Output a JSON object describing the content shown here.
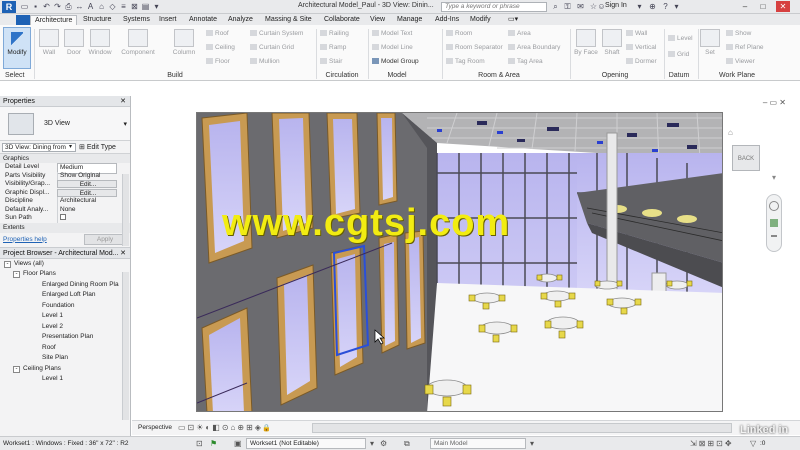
{
  "titlebar": {
    "logo": "R",
    "doc_title": "Architectural Model_Paul - 3D View: Dinin...",
    "search_placeholder": "Type a keyword or phrase",
    "sign_in": "Sign In"
  },
  "tabs": [
    "Architecture",
    "Structure",
    "Systems",
    "Insert",
    "Annotate",
    "Analyze",
    "Massing & Site",
    "Collaborate",
    "View",
    "Manage",
    "Add-Ins",
    "Modify"
  ],
  "ribbon": {
    "modify": "Modify",
    "select": "Select",
    "build_big": [
      "Wall",
      "Door",
      "Window",
      "Component",
      "Column"
    ],
    "build_small": [
      "Roof",
      "Ceiling",
      "Floor",
      "Curtain System",
      "Curtain Grid",
      "Mullion"
    ],
    "circulation": [
      "Railing",
      "Ramp",
      "Stair"
    ],
    "model": [
      "Model Text",
      "Model Line",
      "Model Group"
    ],
    "room_area": [
      "Room",
      "Room Separator",
      "Tag Room",
      "Area",
      "Area Boundary",
      "Tag Area"
    ],
    "opening": [
      "By Face",
      "Shaft",
      "Wall",
      "Vertical",
      "Dormer"
    ],
    "datum": [
      "Level",
      "Grid"
    ],
    "work_plane": [
      "Set",
      "Show",
      "Ref Plane",
      "Viewer"
    ],
    "panel_labels": [
      "Build",
      "Circulation",
      "Model",
      "Room & Area",
      "Opening",
      "Datum",
      "Work Plane"
    ]
  },
  "properties": {
    "header": "Properties",
    "type_name": "3D View",
    "view_selector": "3D View: Dining from",
    "edit_type": "Edit Type",
    "section_graphics": "Graphics",
    "rows": [
      {
        "k": "Detail Level",
        "v": "Medium"
      },
      {
        "k": "Parts Visibility",
        "v": "Show Original"
      },
      {
        "k": "Visibility/Grap...",
        "v": "Edit..."
      },
      {
        "k": "Graphic Displ...",
        "v": "Edit..."
      },
      {
        "k": "Discipline",
        "v": "Architectural"
      },
      {
        "k": "Default Analy...",
        "v": "None"
      },
      {
        "k": "Sun Path",
        "v": ""
      }
    ],
    "section_extents": "Extents",
    "help": "Properties help",
    "apply": "Apply"
  },
  "project_browser": {
    "header": "Project Browser - Architectural Mod...",
    "items": [
      {
        "label": "Views (all)",
        "indent": 0,
        "toggle": "-"
      },
      {
        "label": "Floor Plans",
        "indent": 1,
        "toggle": "-"
      },
      {
        "label": "Enlarged Dining Room Pla",
        "indent": 2,
        "toggle": ""
      },
      {
        "label": "Enlarged Loft Plan",
        "indent": 2,
        "toggle": ""
      },
      {
        "label": "Foundation",
        "indent": 2,
        "toggle": ""
      },
      {
        "label": "Level 1",
        "indent": 2,
        "toggle": ""
      },
      {
        "label": "Level 2",
        "indent": 2,
        "toggle": ""
      },
      {
        "label": "Presentation Plan",
        "indent": 2,
        "toggle": ""
      },
      {
        "label": "Roof",
        "indent": 2,
        "toggle": ""
      },
      {
        "label": "Site Plan",
        "indent": 2,
        "toggle": ""
      },
      {
        "label": "Ceiling Plans",
        "indent": 1,
        "toggle": "-"
      },
      {
        "label": "Level 1",
        "indent": 2,
        "toggle": ""
      }
    ]
  },
  "viewport": {
    "viewcube": "BACK",
    "watermark": "www.cgtsj.com"
  },
  "view_control_bar": {
    "visual_style": "Perspective"
  },
  "statusbar": {
    "message": "Workset1 : Windows : Fixed : 36\" x 72\" : R2",
    "workset": "Workset1 (Not Editable)",
    "design_option": "Main Model",
    "filter_count": ":0"
  },
  "branding": "Linked in",
  "colors": {
    "accent": "#1e62b5",
    "watermark": "#f2ec12"
  }
}
